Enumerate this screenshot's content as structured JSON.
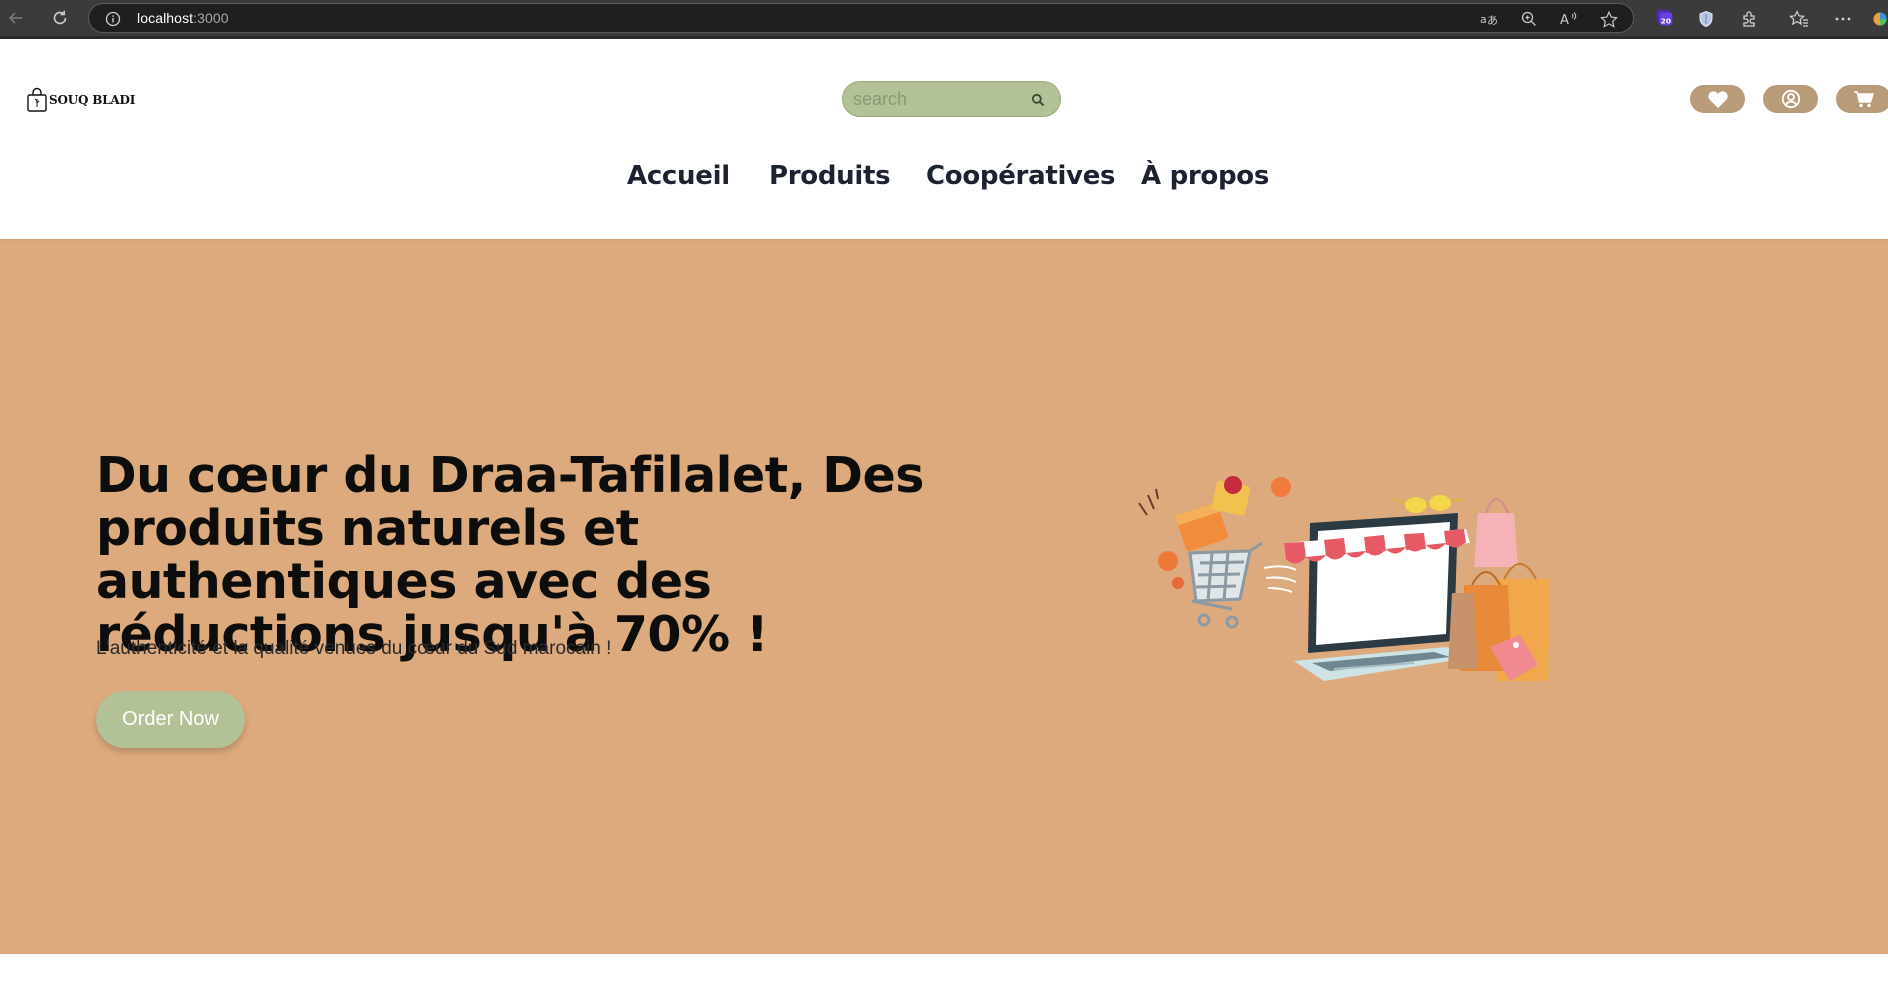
{
  "browser": {
    "url_host": "localhost",
    "url_port": ":3000",
    "extension_badge": "20"
  },
  "site": {
    "logo_text": "SOUQ BLADI",
    "search_placeholder": "search",
    "menu": [
      {
        "label": "Accueil"
      },
      {
        "label": "Produits"
      },
      {
        "label": "Coopératives"
      },
      {
        "label": "À propos"
      }
    ]
  },
  "hero": {
    "title": "Du cœur du Draa-Tafilalet, Des produits naturels et authentiques avec des réductions jusqu'à 70% !",
    "subtitle": "L’authenticité et la qualité venues du cœur du Sud marocain !",
    "cta_label": "Order Now"
  },
  "colors": {
    "hero_bg": "#ddaa7e",
    "accent_green": "#b3c196",
    "icon_pill": "#b89c79",
    "menu_text": "#1c2230"
  },
  "icons": [
    "back-arrow-icon",
    "reload-icon",
    "info-icon",
    "translate-icon",
    "zoom-icon",
    "read-aloud-icon",
    "favorite-star-icon",
    "copilot-icon",
    "shield-icon",
    "extensions-icon",
    "favorites-icon",
    "more-icon",
    "shopping-bag-logo-icon",
    "search-icon",
    "heart-icon",
    "user-icon",
    "cart-icon"
  ]
}
